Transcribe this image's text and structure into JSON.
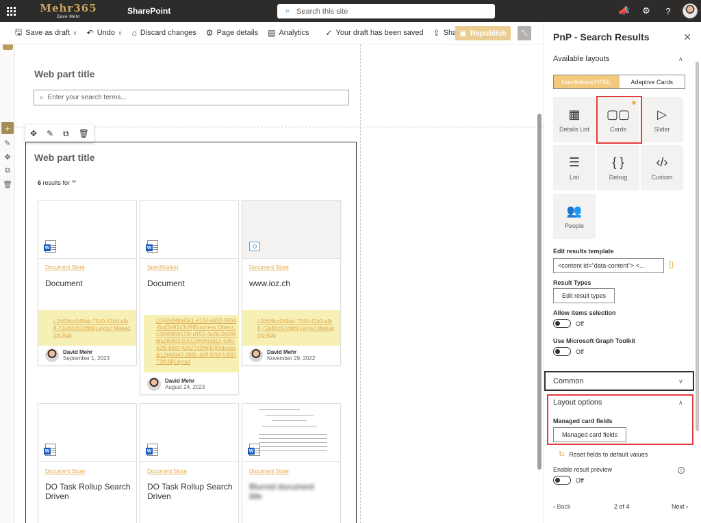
{
  "suite": {
    "brand": "Mehr365",
    "brand_sub": "Dave Mehr",
    "app_name": "SharePoint",
    "search_placeholder": "Search this site"
  },
  "commands": {
    "save_draft": "Save as draft",
    "undo": "Undo",
    "discard": "Discard changes",
    "page_details": "Page details",
    "analytics": "Analytics",
    "draft_status": "Your draft has been saved",
    "share": "Share",
    "republish": "Republish"
  },
  "canvas": {
    "search_wp_title": "Web part title",
    "search_placeholder": "Enter your search terms...",
    "results_wp_title": "Web part title",
    "results_count": "6",
    "results_suffix": " results for '*'"
  },
  "cards": [
    {
      "category": "Document Store",
      "title": "Document",
      "tags": "L0|#09cc049ab-7540-41b3-afb8-72a83c57c8b5|Layout Managing App",
      "author": "David Mehr",
      "date": "September 1, 2023",
      "icon": "word-doc-icon"
    },
    {
      "category": "Specification",
      "title": "Document",
      "tags": "L0|#0e98bd041-a12d-4432-9004-6bd2e9243cf9|Business Object;L0|#0f859129f-d152-4e2b-3b065bfa2835|2.0.0;L0|#0f02d12-53fd-42f9-b99f-42627d2f6f40|Released;L0|#0d40-3895-4bff-976f-53f3771ffcf4|Layout",
      "author": "David Mehr",
      "date": "August 24, 2023",
      "icon": "word-doc-icon"
    },
    {
      "category": "Document Store",
      "title": "www.ioz.ch",
      "tags": "L0|#09cc049ab-7540-41b3-afb8-72a83c57c8b5|Layout Managing App",
      "author": "David Mehr",
      "date": "November 29, 2022",
      "icon": "link-icon"
    },
    {
      "category": "Document Store",
      "title": "DO Task Rollup Search Driven",
      "icon": "word-doc-icon"
    },
    {
      "category": "Document Store",
      "title": "DO Task Rollup Search Driven",
      "icon": "word-doc-icon"
    },
    {
      "category": "Document Store",
      "title": "Blurred document title",
      "icon": "word-doc-icon"
    }
  ],
  "panel": {
    "title": "PnP - Search Results",
    "available_layouts": "Available layouts",
    "seg_handlebars": "Handlebars/HTML",
    "seg_adaptive": "Adaptive Cards",
    "layouts": [
      "Details List",
      "Cards",
      "Slider",
      "List",
      "Debug",
      "Custom",
      "People"
    ],
    "edit_template_label": "Edit results template",
    "template_value": "<content id=\"data-content\">   <...",
    "result_types_label": "Result Types",
    "edit_result_types": "Edit result types",
    "allow_selection_label": "Allow items selection",
    "allow_selection_state": "Off",
    "graph_toolkit_label": "Use Microsoft Graph Toolkit",
    "graph_toolkit_state": "Off",
    "common": "Common",
    "layout_options": "Layout options",
    "managed_fields_label": "Managed card fields",
    "managed_fields_button": "Managed card fields",
    "reset_fields": "Reset fields to default values",
    "preview_label": "Enable result preview",
    "preview_state": "Off",
    "back": "Back",
    "page_pos": "2 of 4",
    "next": "Next"
  },
  "colors": {
    "accent": "#e0a94a",
    "republish": "#ebcd91",
    "highlight_border": "#e33a40",
    "tag_background": "#f7f0b5"
  }
}
